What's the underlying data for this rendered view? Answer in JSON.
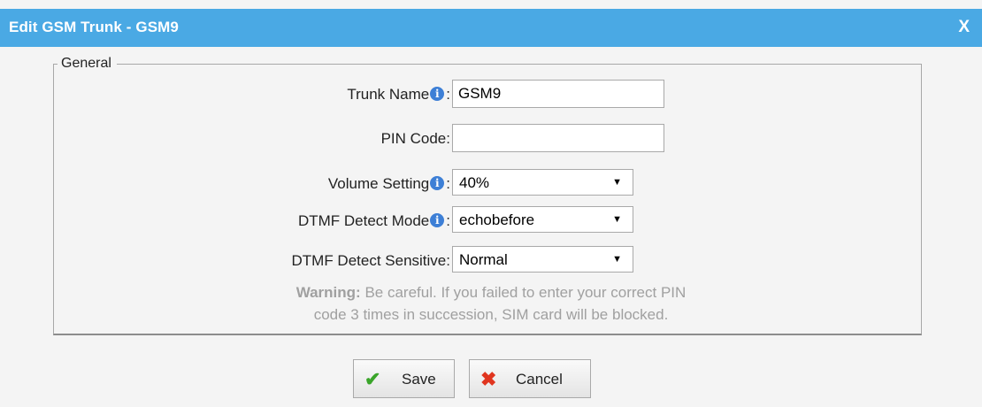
{
  "dialog": {
    "title": "Edit GSM Trunk - GSM9",
    "close_label": "X"
  },
  "general": {
    "legend": "General",
    "trunk_name": {
      "label": "Trunk Name",
      "value": "GSM9"
    },
    "pin_code": {
      "label": "PIN Code:",
      "value": ""
    },
    "volume_setting": {
      "label": "Volume Setting",
      "value": "40%"
    },
    "dtmf_detect_mode": {
      "label": "DTMF Detect Mode",
      "value": "echobefore"
    },
    "dtmf_detect_sensitive": {
      "label": "DTMF Detect Sensitive:",
      "value": "Normal"
    },
    "warning": {
      "strong": "Warning:",
      "line1": "Be careful. If you failed to enter your correct PIN",
      "line2": "code 3 times in succession, SIM card will be blocked."
    }
  },
  "buttons": {
    "save": "Save",
    "cancel": "Cancel"
  },
  "icons": {
    "info": "info-icon",
    "check": "check-icon",
    "cross": "cross-icon",
    "dropdown": "dropdown-arrow-icon"
  },
  "colors": {
    "titlebar": "#4aa9e4",
    "info_icon": "#3d7fd6",
    "save_check": "#3aa52a",
    "cancel_x": "#e0351f",
    "warning_text": "#a0a0a0"
  }
}
